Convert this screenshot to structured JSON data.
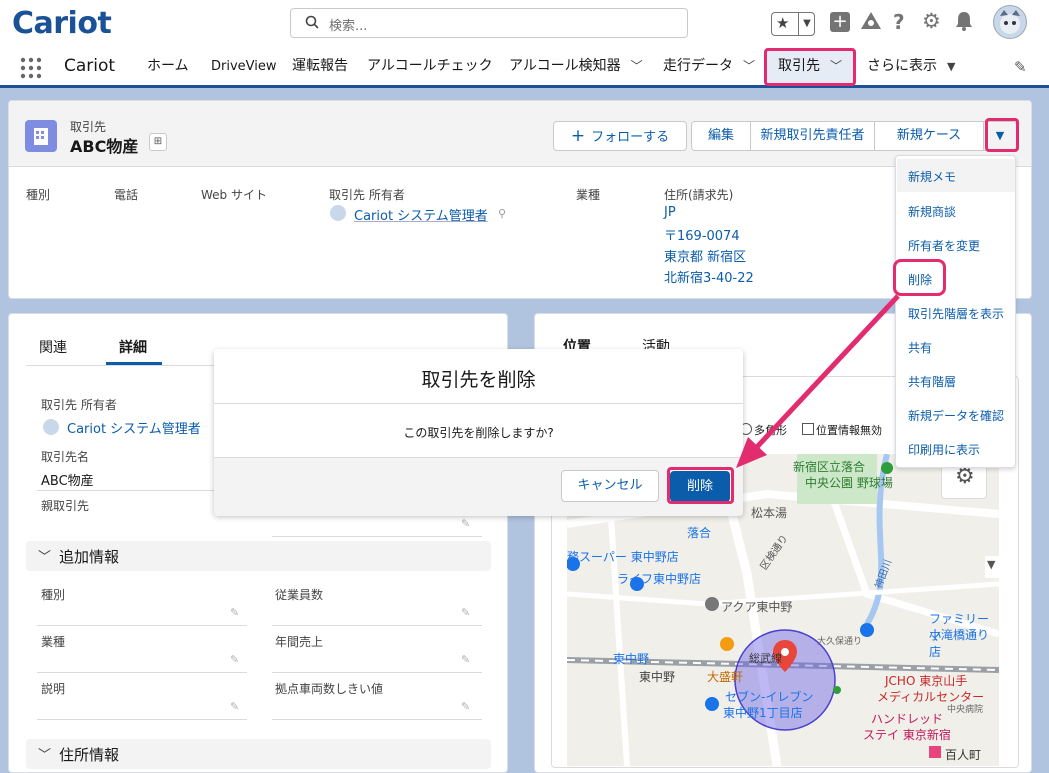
{
  "app": {
    "logo": "Cariot",
    "app_name": "Cariot"
  },
  "search": {
    "placeholder": "検索..."
  },
  "nav": {
    "items": [
      {
        "label": "ホーム"
      },
      {
        "label": "DriveView"
      },
      {
        "label": "運転報告"
      },
      {
        "label": "アルコールチェック"
      },
      {
        "label": "アルコール検知器"
      },
      {
        "label": "走行データ"
      },
      {
        "label": "取引先"
      },
      {
        "label": "さらに表示"
      }
    ]
  },
  "record": {
    "object_label": "取引先",
    "name": "ABC物産",
    "buttons": {
      "follow": "フォローする",
      "edit": "編集",
      "new_contact": "新規取引先責任者",
      "new_case": "新規ケース"
    },
    "fields": {
      "type_label": "種別",
      "phone_label": "電話",
      "website_label": "Web サイト",
      "owner_label": "取引先 所有者",
      "owner_value": "Cariot システム管理者",
      "industry_label": "業種",
      "address_label": "住所(請求先)",
      "address_lines": [
        "JP",
        "〒169-0074",
        "東京都 新宿区",
        "北新宿3-40-22"
      ]
    }
  },
  "dropdown": {
    "items": [
      "新規メモ",
      "新規商談",
      "所有者を変更",
      "削除",
      "取引先階層を表示",
      "共有",
      "共有階層",
      "新規データを確認",
      "印刷用に表示"
    ]
  },
  "left_panel": {
    "tabs": [
      "関連",
      "詳細"
    ],
    "owner_label": "取引先 所有者",
    "owner_value": "Cariot システム管理者",
    "name_label": "取引先名",
    "name_value": "ABC物産",
    "parent_label": "親取引先",
    "section_additional": "追加情報",
    "fields": [
      "種別",
      "従業員数",
      "業種",
      "年間売上",
      "説明",
      "拠点車両数しきい値"
    ],
    "section_address": "住所情報"
  },
  "right_panel": {
    "tabs": [
      "位置",
      "活動"
    ],
    "map_options": [
      "多角形",
      "位置情報無効"
    ],
    "map_labels": [
      "新宿区立落合",
      "中央公園 野球場",
      "松本湯",
      "落合",
      "務スーパー 東中野店",
      "ライフ東中野店",
      "区検通り",
      "神田川",
      "アクア東中野",
      "ファミリーマ",
      "小滝橋通り店",
      "東中野",
      "東中野",
      "大盛軒",
      "総武線",
      "セブン-イレブン",
      "東中野1丁目店",
      "JCHO 東京山手",
      "メディカルセンター",
      "ハンドレッド",
      "ステイ 東京新宿",
      "百人町",
      "大久保通り",
      "中央病院"
    ]
  },
  "modal": {
    "title": "取引先を削除",
    "message": "この取引先を削除しますか?",
    "cancel": "キャンセル",
    "confirm": "削除"
  },
  "colors": {
    "brand": "#1b5297",
    "accent_link": "#0b5cab",
    "highlight": "#e32b6f",
    "primary_button": "#0b5cab"
  }
}
